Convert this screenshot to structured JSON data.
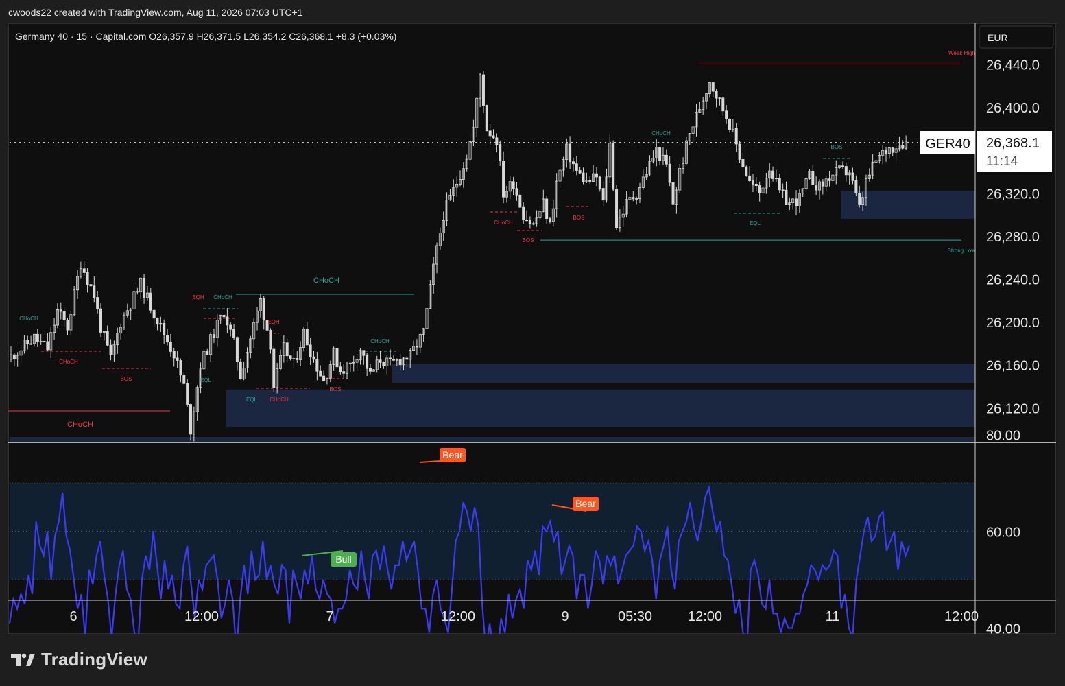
{
  "header": {
    "attribution": "cwoods22 created with TradingView.com, Aug 11, 2026 07:03 UTC+1"
  },
  "legend": {
    "text": "Germany 40 · 15 · Capital.com  O26,357.9  H26,371.5  L26,354.2  C26,368.1  +8.3 (+0.03%)"
  },
  "currency_button": "EUR",
  "price_tag": {
    "symbol": "GER40",
    "price": "26,368.1",
    "countdown": "11:14"
  },
  "brand": {
    "name": "TradingView"
  },
  "colors": {
    "background": "#0f0f0f",
    "candle": "#d8d8d8",
    "bull_label": "#26a69a",
    "bear_label": "#f23645",
    "rsi_line": "#3b3bf5",
    "rsi_band": "#102030",
    "zone": "#1b2740",
    "bull_tag": "#4caf50",
    "bear_tag": "#ff5722"
  },
  "chart_data": [
    {
      "type": "candlestick",
      "title": "Germany 40 · 15 · Capital.com",
      "currency": "EUR",
      "ylim": [
        26095,
        26460
      ],
      "y_ticks": [
        "26,440.0",
        "26,400.0",
        "26,320.0",
        "26,280.0",
        "26,240.0",
        "26,200.0",
        "26,160.0",
        "26,120.0"
      ],
      "x_ticks": [
        "6",
        "12:00",
        "7",
        "12:00",
        "9",
        "05:30",
        "12:00",
        "11",
        "12:00"
      ],
      "last_close": 26368.1,
      "price_path_points": [
        [
          0,
          26165
        ],
        [
          8,
          26185
        ],
        [
          12,
          26175
        ],
        [
          15,
          26210
        ],
        [
          18,
          26195
        ],
        [
          22,
          26255
        ],
        [
          26,
          26225
        ],
        [
          28,
          26195
        ],
        [
          31,
          26165
        ],
        [
          34,
          26200
        ],
        [
          40,
          26235
        ],
        [
          43,
          26215
        ],
        [
          46,
          26195
        ],
        [
          50,
          26170
        ],
        [
          53,
          26140
        ],
        [
          55,
          26100
        ],
        [
          58,
          26160
        ],
        [
          62,
          26190
        ],
        [
          65,
          26210
        ],
        [
          68,
          26180
        ],
        [
          70,
          26150
        ],
        [
          73,
          26185
        ],
        [
          76,
          26220
        ],
        [
          79,
          26180
        ],
        [
          80,
          26140
        ],
        [
          83,
          26175
        ],
        [
          86,
          26160
        ],
        [
          89,
          26190
        ],
        [
          92,
          26165
        ],
        [
          95,
          26145
        ],
        [
          98,
          26170
        ],
        [
          100,
          26155
        ],
        [
          103,
          26160
        ],
        [
          106,
          26175
        ],
        [
          109,
          26150
        ],
        [
          112,
          26165
        ],
        [
          115,
          26160
        ],
        [
          118,
          26165
        ],
        [
          121,
          26168
        ],
        [
          125,
          26190
        ],
        [
          128,
          26250
        ],
        [
          131,
          26300
        ],
        [
          135,
          26330
        ],
        [
          138,
          26355
        ],
        [
          140,
          26380
        ],
        [
          142,
          26430
        ],
        [
          144,
          26380
        ],
        [
          147,
          26370
        ],
        [
          149,
          26320
        ],
        [
          152,
          26330
        ],
        [
          155,
          26300
        ],
        [
          158,
          26290
        ],
        [
          161,
          26310
        ],
        [
          163,
          26290
        ],
        [
          165,
          26330
        ],
        [
          168,
          26360
        ],
        [
          171,
          26340
        ],
        [
          174,
          26330
        ],
        [
          177,
          26335
        ],
        [
          179,
          26310
        ],
        [
          181,
          26365
        ],
        [
          183,
          26290
        ],
        [
          186,
          26310
        ],
        [
          189,
          26320
        ],
        [
          192,
          26340
        ],
        [
          195,
          26360
        ],
        [
          198,
          26345
        ],
        [
          200,
          26310
        ],
        [
          202,
          26340
        ],
        [
          205,
          26375
        ],
        [
          208,
          26400
        ],
        [
          211,
          26425
        ],
        [
          214,
          26405
        ],
        [
          217,
          26385
        ],
        [
          220,
          26355
        ],
        [
          223,
          26330
        ],
        [
          226,
          26320
        ],
        [
          229,
          26345
        ],
        [
          232,
          26320
        ],
        [
          235,
          26310
        ],
        [
          238,
          26315
        ],
        [
          241,
          26335
        ],
        [
          244,
          26325
        ],
        [
          247,
          26335
        ],
        [
          250,
          26340
        ],
        [
          253,
          26340
        ],
        [
          256,
          26305
        ],
        [
          258,
          26330
        ],
        [
          261,
          26350
        ],
        [
          264,
          26360
        ],
        [
          267,
          26365
        ],
        [
          270,
          26368
        ]
      ],
      "annotations": [
        {
          "text": "CHoCH",
          "color": "bear"
        },
        {
          "text": "CHoCH",
          "color": "bull"
        },
        {
          "text": "CHoCH",
          "color": "bear"
        },
        {
          "text": "BOS",
          "color": "bear"
        },
        {
          "text": "EQL",
          "color": "bull"
        },
        {
          "text": "EQH",
          "color": "bear"
        },
        {
          "text": "CHoCH",
          "color": "bull"
        },
        {
          "text": "EQH",
          "color": "bear"
        },
        {
          "text": "EQL",
          "color": "bull"
        },
        {
          "text": "CHoCH",
          "color": "bear"
        },
        {
          "text": "BOS",
          "color": "bear"
        },
        {
          "text": "CHoCH",
          "color": "bull"
        },
        {
          "text": "CHoCH",
          "color": "bull"
        },
        {
          "text": "CHoCH",
          "color": "bear"
        },
        {
          "text": "BOS",
          "color": "bear"
        },
        {
          "text": "BOS",
          "color": "bear"
        },
        {
          "text": "CHoCH",
          "color": "bull"
        },
        {
          "text": "EQL",
          "color": "bull"
        },
        {
          "text": "BOS",
          "color": "bull"
        },
        {
          "text": "Weak High",
          "color": "bear"
        },
        {
          "text": "Strong Low",
          "color": "bull"
        }
      ],
      "demand_zones": [
        {
          "from": 26143,
          "to": 26161
        },
        {
          "from": 26102,
          "to": 26137
        },
        {
          "from": 26296,
          "to": 26322
        }
      ],
      "levels": [
        {
          "name": "Weak High",
          "price": 26440
        },
        {
          "name": "Strong Low",
          "price": 26276
        }
      ]
    },
    {
      "type": "line",
      "panel": "oscillator",
      "ylim": [
        25,
        85
      ],
      "y_ticks": [
        "80.00",
        "60.00",
        "40.00"
      ],
      "bands": [
        30,
        50,
        70
      ],
      "last_value": 57,
      "values": [
        41,
        46,
        44,
        47,
        45,
        51,
        47,
        62,
        57,
        55,
        60,
        50,
        59,
        62,
        68,
        59,
        56,
        50,
        44,
        47,
        38,
        52,
        49,
        55,
        58,
        51,
        46,
        38,
        47,
        53,
        56,
        48,
        46,
        39,
        37,
        50,
        55,
        52,
        60,
        53,
        46,
        54,
        48,
        51,
        45,
        44,
        53,
        57,
        49,
        42,
        50,
        48,
        53,
        54,
        55,
        50,
        42,
        45,
        50,
        46,
        35,
        46,
        53,
        47,
        56,
        50,
        51,
        58,
        50,
        53,
        49,
        47,
        53,
        52,
        41,
        52,
        49,
        46,
        52,
        49,
        55,
        48,
        46,
        50,
        47,
        46,
        41,
        44,
        44,
        46,
        52,
        49,
        48,
        56,
        50,
        46,
        55,
        56,
        52,
        57,
        52,
        48,
        53,
        53,
        58,
        54,
        56,
        58,
        52,
        44,
        44,
        39,
        47,
        50,
        44,
        42,
        39,
        48,
        58,
        60,
        66,
        64,
        60,
        65,
        61,
        45,
        35,
        41,
        35,
        34,
        42,
        39,
        47,
        42,
        46,
        48,
        44,
        54,
        52,
        56,
        51,
        61,
        60,
        62,
        58,
        60,
        51,
        54,
        57,
        55,
        46,
        51,
        51,
        44,
        49,
        56,
        54,
        49,
        55,
        53,
        55,
        49,
        52,
        55,
        56,
        57,
        61,
        60,
        56,
        58,
        54,
        46,
        54,
        57,
        61,
        52,
        48,
        58,
        60,
        62,
        66,
        61,
        58,
        62,
        67,
        69,
        64,
        60,
        62,
        55,
        54,
        49,
        43,
        46,
        39,
        35,
        52,
        54,
        51,
        45,
        44,
        50,
        43,
        43,
        39,
        42,
        40,
        40,
        43,
        43,
        47,
        49,
        53,
        52,
        50,
        53,
        52,
        53,
        56,
        55,
        44,
        47,
        40,
        38,
        50,
        55,
        60,
        63,
        58,
        59,
        63,
        64,
        56,
        58,
        60,
        52,
        58,
        55,
        57
      ],
      "divergences": [
        {
          "label": "Bull",
          "kind": "bull"
        },
        {
          "label": "Bear",
          "kind": "bear"
        },
        {
          "label": "Bear",
          "kind": "bear"
        }
      ]
    }
  ]
}
